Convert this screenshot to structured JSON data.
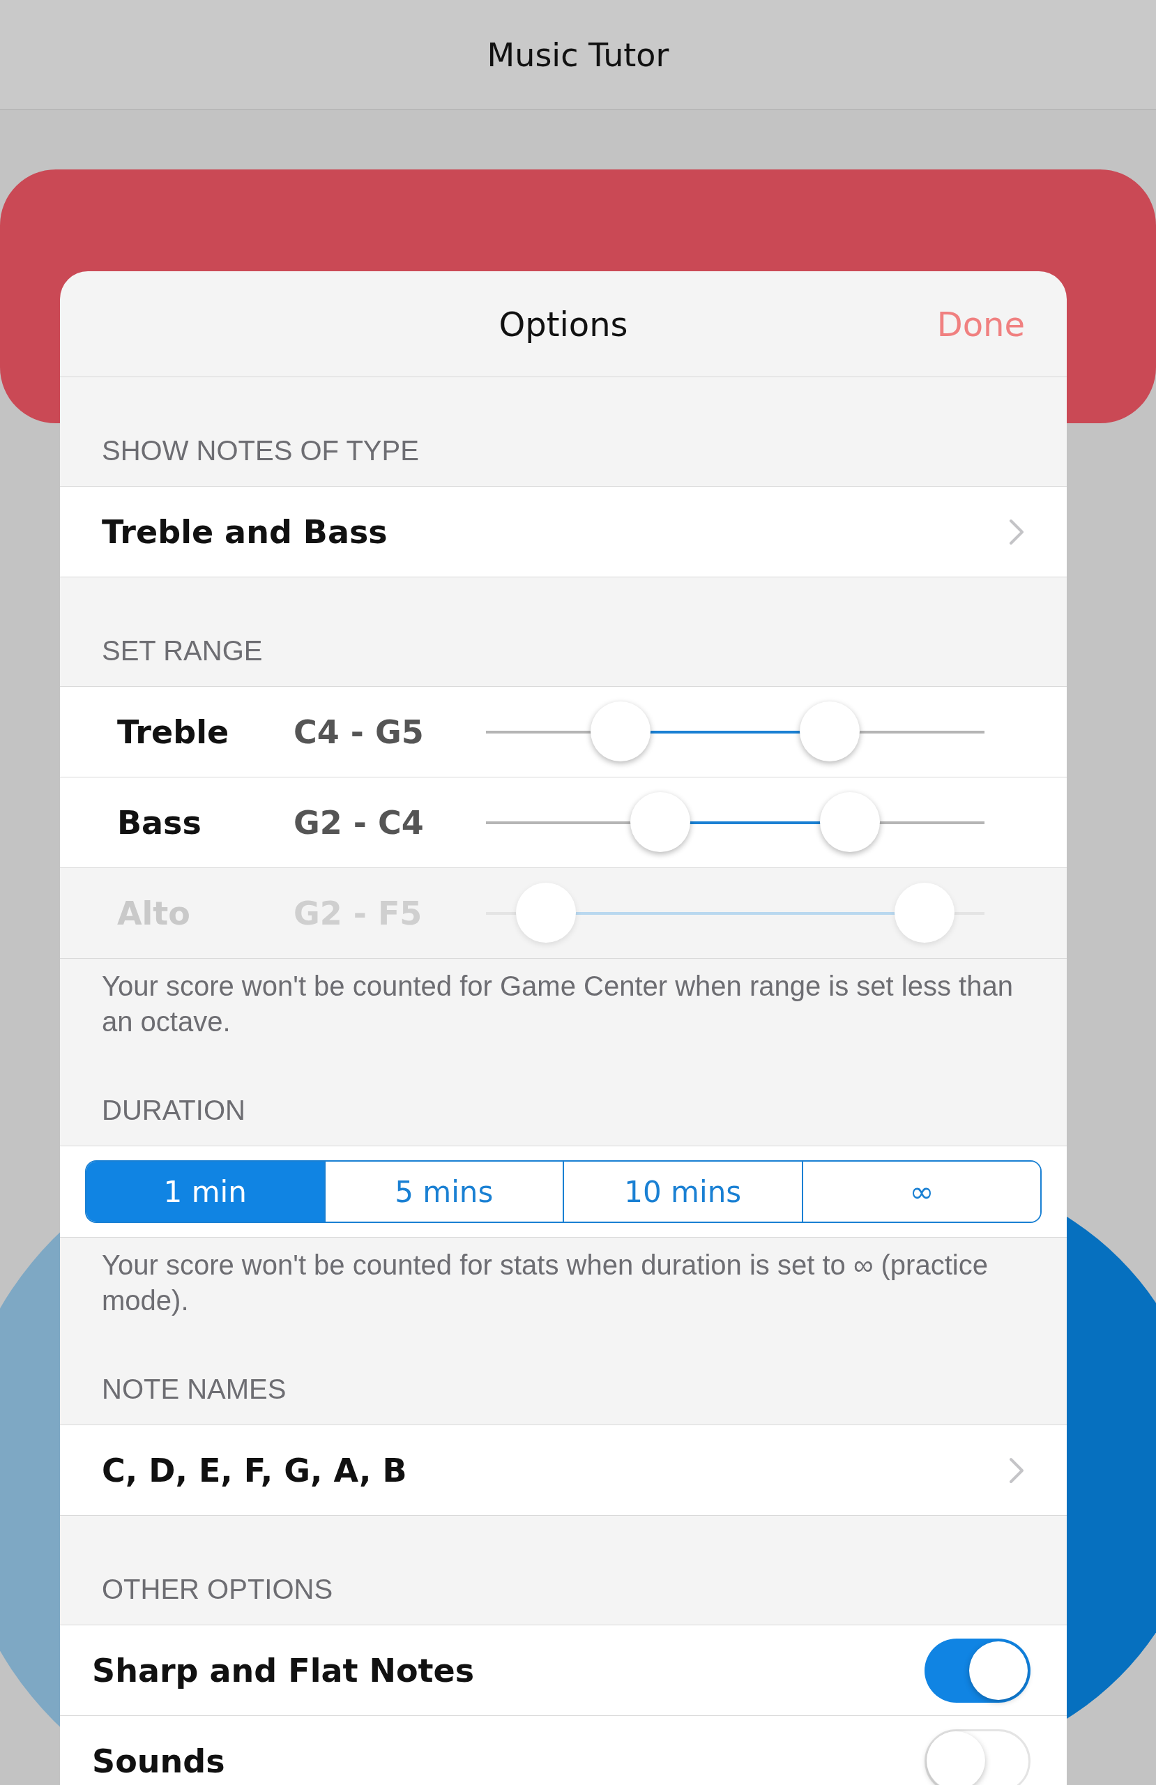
{
  "nav_bar": {
    "title": "Music Tutor"
  },
  "dialog": {
    "title": "Options",
    "done_button": "Done"
  },
  "sections": [
    {
      "kind": "picker",
      "header": "SHOW NOTES OF TYPE",
      "value": "Treble and Bass"
    },
    {
      "kind": "ranges",
      "header": "SET RANGE",
      "rows": [
        {
          "label": "Treble",
          "range": "C4 - G5",
          "disabled": false,
          "thumbs": [
            {
              "level": 0.27
            },
            {
              "level": 0.69
            }
          ]
        },
        {
          "label": "Bass",
          "range": "G2 - C4",
          "disabled": false,
          "thumbs": [
            {
              "level": 0.35
            },
            {
              "level": 0.73
            }
          ]
        },
        {
          "label": "Alto",
          "range": "G2 - F5",
          "disabled": true,
          "thumbs": [
            {
              "level": 0.12
            },
            {
              "level": 0.88
            }
          ]
        }
      ],
      "footer": "Your score won't be counted for Game Center when range is set less than an octave."
    },
    {
      "kind": "segmented",
      "header": "DURATION",
      "segments": [
        {
          "label": "1 min",
          "selected": true
        },
        {
          "label": "5 mins",
          "selected": false
        },
        {
          "label": "10 mins",
          "selected": false
        },
        {
          "label": "∞",
          "selected": false
        }
      ],
      "footer": "Your score won't be counted for stats when duration is set to ∞ (practice mode)."
    },
    {
      "kind": "picker",
      "header": "NOTE NAMES",
      "value": "C, D, E, F, G, A, B"
    },
    {
      "kind": "toggles",
      "header": "OTHER OPTIONS",
      "rows": [
        {
          "label": "Sharp and Flat Notes",
          "on": true
        },
        {
          "label": "Sounds",
          "on": false
        }
      ]
    }
  ]
}
